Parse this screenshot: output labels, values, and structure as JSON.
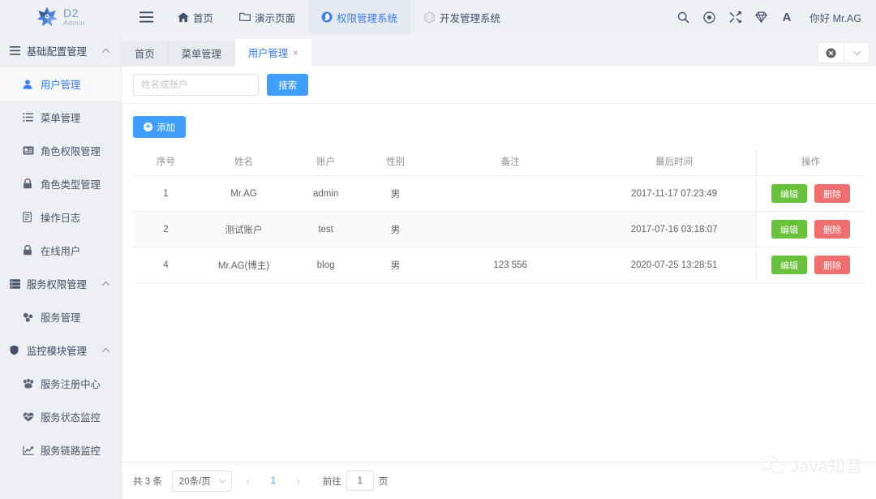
{
  "brand": {
    "name": "D2",
    "sub": "Admin"
  },
  "header": {
    "menu_toggle": "menu-icon",
    "nav": [
      {
        "label": "首页",
        "icon": "home-icon",
        "active": false
      },
      {
        "label": "演示页面",
        "icon": "folder-icon",
        "active": false
      },
      {
        "label": "权限管理系统",
        "icon": "shield-globe-icon",
        "active": true
      },
      {
        "label": "开发管理系统",
        "icon": "hexagon-icon",
        "active": false
      }
    ],
    "actions": [
      {
        "name": "search-icon",
        "label": "搜索"
      },
      {
        "name": "theme-icon",
        "label": "主题"
      },
      {
        "name": "shuffle-icon",
        "label": "随机"
      },
      {
        "name": "gem-icon",
        "label": "皮肤"
      },
      {
        "name": "font-size-icon",
        "label": "A"
      }
    ],
    "greeting": "你好 Mr.AG"
  },
  "sidebar": {
    "groups": [
      {
        "label": "基础配置管理",
        "icon": "list-bars-icon",
        "expanded": true,
        "items": [
          {
            "label": "用户管理",
            "icon": "user-icon",
            "active": true
          },
          {
            "label": "菜单管理",
            "icon": "menu-list-icon",
            "active": false
          },
          {
            "label": "角色权限管理",
            "icon": "id-card-icon",
            "active": false
          },
          {
            "label": "角色类型管理",
            "icon": "lock-icon",
            "active": false
          },
          {
            "label": "操作日志",
            "icon": "document-icon",
            "active": false
          },
          {
            "label": "在线用户",
            "icon": "lock-icon",
            "active": false
          }
        ]
      },
      {
        "label": "服务权限管理",
        "icon": "server-icon",
        "expanded": true,
        "items": [
          {
            "label": "服务管理",
            "icon": "cubes-icon",
            "active": false
          }
        ]
      },
      {
        "label": "监控模块管理",
        "icon": "shield-icon",
        "expanded": true,
        "items": [
          {
            "label": "服务注册中心",
            "icon": "paw-icon",
            "active": false
          },
          {
            "label": "服务状态监控",
            "icon": "heartbeat-icon",
            "active": false
          },
          {
            "label": "服务链路监控",
            "icon": "chart-line-icon",
            "active": false
          }
        ]
      }
    ]
  },
  "tabbar": {
    "tabs": [
      {
        "label": "首页",
        "active": false,
        "closable": false
      },
      {
        "label": "菜单管理",
        "active": false,
        "closable": false
      },
      {
        "label": "用户管理",
        "active": true,
        "closable": true,
        "close": "×"
      }
    ],
    "tools": [
      {
        "name": "close-circle-icon"
      },
      {
        "name": "chevron-down-icon"
      }
    ]
  },
  "filter": {
    "placeholder": "姓名或账户",
    "value": "",
    "search_label": "搜索"
  },
  "toolbar": {
    "add_label": "添加",
    "add_icon": "plus-circle-icon"
  },
  "table": {
    "columns": [
      "序号",
      "姓名",
      "账户",
      "性别",
      "备注",
      "最后时间",
      "操作"
    ],
    "rows": [
      {
        "no": "1",
        "name": "Mr.AG",
        "account": "admin",
        "gender": "男",
        "remark": "",
        "last_time": "2017-11-17 07:23:49"
      },
      {
        "no": "2",
        "name": "测试账户",
        "account": "test",
        "gender": "男",
        "remark": "",
        "last_time": "2017-07-16 03:18:07"
      },
      {
        "no": "4",
        "name": "Mr.AG(博主)",
        "account": "blog",
        "gender": "男",
        "remark": "123 556",
        "last_time": "2020-07-25 13:28:51"
      }
    ],
    "op_edit": "编辑",
    "op_delete": "删除"
  },
  "pagination": {
    "total_label": "共 3 条",
    "page_size": "20条/页",
    "prev": "‹",
    "next": "›",
    "current_page": "1",
    "jump_prefix": "前往",
    "jump_value": "1",
    "jump_suffix": "页"
  },
  "watermark": {
    "text": "Java知音",
    "icon": "wechat-icon"
  },
  "colors": {
    "primary": "#409eff",
    "nav_active": "#3a7afe",
    "success": "#67c23a",
    "danger": "#ef6f6f",
    "header_bg": "#eef0f4",
    "sidebar_bg": "#edeff3",
    "page_bg": "#f0f2f5"
  }
}
